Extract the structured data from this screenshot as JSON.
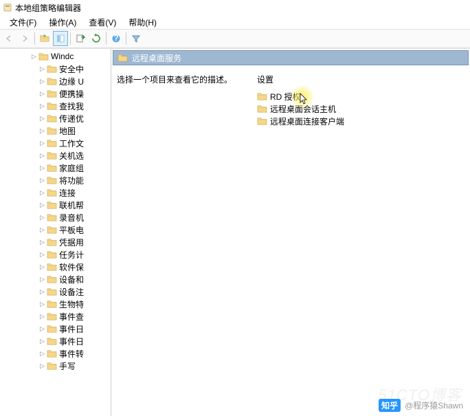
{
  "title": "本地组策略编辑器",
  "menu": {
    "file": "文件(F)",
    "action": "操作(A)",
    "view": "查看(V)",
    "help": "帮助(H)"
  },
  "tree": {
    "first": "Windc",
    "items": [
      "安全中",
      "边缘 U",
      "便携操",
      "查找我",
      "传递优",
      "地图",
      "工作文",
      "关机选",
      "家庭组",
      "将功能",
      "连接",
      "联机帮",
      "录音机",
      "平板电",
      "凭据用",
      "任务计",
      "软件保",
      "设备和",
      "设备注",
      "生物特",
      "事件查",
      "事件日",
      "事件日",
      "事件转",
      "手写"
    ]
  },
  "content": {
    "header": "远程桌面服务",
    "left_text": "选择一个项目来查看它的描述。",
    "right_title": "设置",
    "items": [
      "RD 授权",
      "远程桌面会话主机",
      "远程桌面连接客户端"
    ]
  },
  "watermark": "51CTO博客",
  "footer": {
    "badge": "知乎",
    "name": "@程序猿Shawn"
  }
}
